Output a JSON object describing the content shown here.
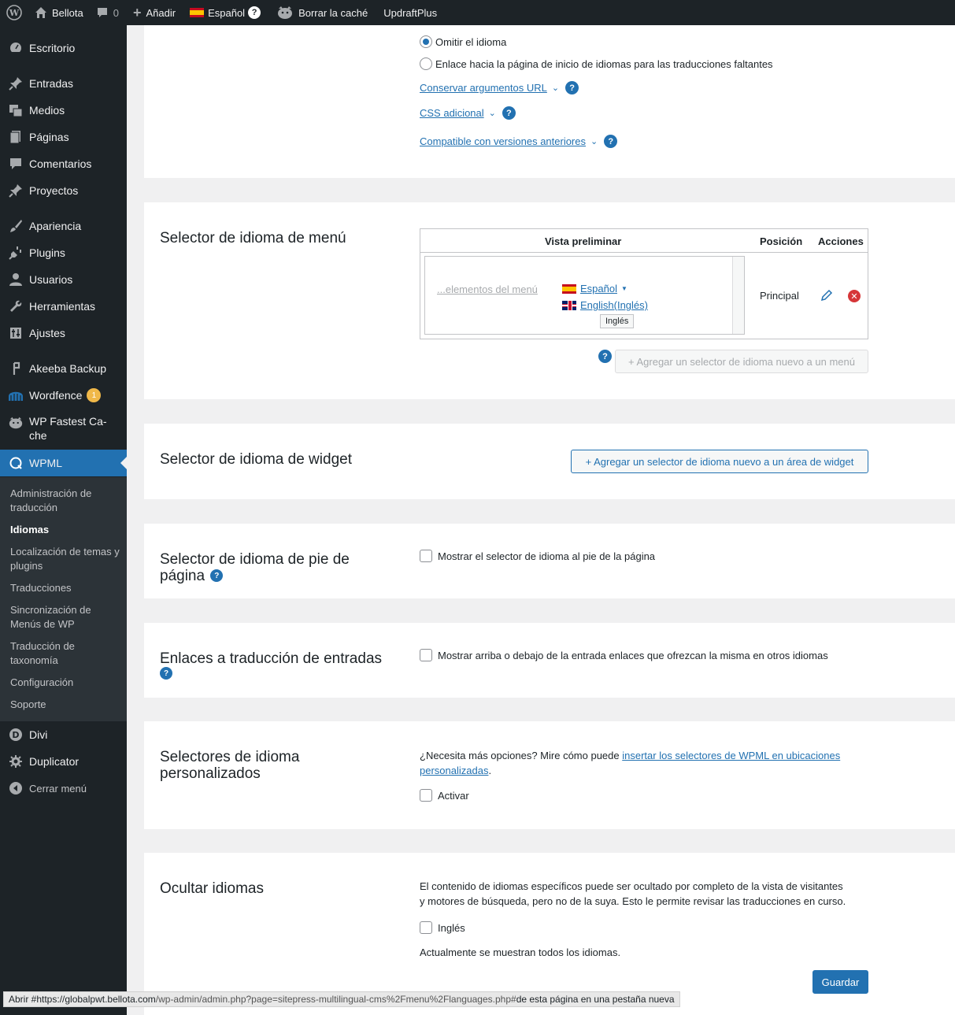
{
  "adminbar": {
    "site_name": "Bellota",
    "comments_count": "0",
    "add_label": "Añadir",
    "language_label": "Español",
    "cache_label": "Borrar la caché",
    "updraft_label": "UpdraftPlus"
  },
  "sidebar": {
    "items": [
      {
        "label": "Escritorio",
        "icon": "dashboard-icon"
      },
      {
        "label": "Entradas",
        "icon": "pin-icon"
      },
      {
        "label": "Medios",
        "icon": "media-icon"
      },
      {
        "label": "Páginas",
        "icon": "pages-icon"
      },
      {
        "label": "Comentarios",
        "icon": "comment-icon"
      },
      {
        "label": "Proyectos",
        "icon": "pin-icon"
      },
      {
        "label": "Apariencia",
        "icon": "brush-icon"
      },
      {
        "label": "Plugins",
        "icon": "plugin-icon"
      },
      {
        "label": "Usuarios",
        "icon": "user-icon"
      },
      {
        "label": "Herramientas",
        "icon": "wrench-icon"
      },
      {
        "label": "Ajustes",
        "icon": "settings-icon"
      },
      {
        "label": "Akeeba Backup",
        "icon": "akeeba-icon"
      },
      {
        "label": "Wordfence",
        "icon": "wordfence-icon",
        "badge": "1"
      },
      {
        "label": "WP Fastest Ca-che",
        "icon": "cheetah-icon"
      },
      {
        "label": "WPML",
        "icon": "wpml-icon"
      },
      {
        "label": "Divi",
        "icon": "divi-icon"
      },
      {
        "label": "Duplicator",
        "icon": "duplicator-icon"
      },
      {
        "label": "Cerrar menú",
        "icon": "collapse-icon"
      }
    ],
    "submenu": [
      "Administración de traducción",
      "Idiomas",
      "Localización de temas y plugins",
      "Traducciones",
      "Sincronización de Menús de WP",
      "Traducción de taxonomía",
      "Configuración",
      "Soporte"
    ],
    "fastest_cache_line1": "WP Fastest Ca-",
    "fastest_cache_line2": "che"
  },
  "top_panel": {
    "radio_skip": "Omitir el idioma",
    "radio_link_home": "Enlace hacia la página de inicio de idiomas para las traducciones faltantes",
    "preserve_url": "Conservar argumentos URL",
    "additional_css": "CSS adicional",
    "backwards_compat": "Compatible con versiones anteriores"
  },
  "menu_selector": {
    "title": "Selector de idioma de menú",
    "col_preview": "Vista preliminar",
    "col_position": "Posición",
    "col_actions": "Acciones",
    "menu_items_text": "...elementos del menú",
    "lang_current": "Español",
    "lang_other": "English(Inglés)",
    "tooltip": "Inglés",
    "position_value": "Principal",
    "add_button": "+ Agregar un selector de idioma nuevo a un menú"
  },
  "widget_selector": {
    "title": "Selector de idioma de widget",
    "add_button": "+ Agregar un selector de idioma nuevo a un área de widget"
  },
  "footer_selector": {
    "title_line1": "Selector de idioma de pie de",
    "title_line2": "página",
    "checkbox_label": "Mostrar el selector de idioma al pie de la página"
  },
  "post_links": {
    "title": "Enlaces a traducción de entradas",
    "checkbox_label": "Mostrar arriba o debajo de la entrada enlaces que ofrezcan la misma en otros idiomas"
  },
  "custom_selectors": {
    "title_line1": "Selectores de idioma",
    "title_line2": "personalizados",
    "text_before": "¿Necesita más opciones? Mire cómo puede ",
    "link_line1": "insertar los selectores de WPML en ubicaciones",
    "link_line2": "personalizadas",
    "text_after": ".",
    "checkbox_label": "Activar"
  },
  "hide_languages": {
    "title": "Ocultar idiomas",
    "desc_line1": "El contenido de idiomas específicos puede ser ocultado por completo de la vista de visitantes",
    "desc_line2": "y motores de búsqueda, pero no de la suya. Esto le permite revisar las traducciones en curso.",
    "checkbox_label": "Inglés",
    "status": "Actualmente se muestran todos los idiomas.",
    "save_button": "Guardar"
  },
  "statusbar": {
    "prefix": "Abrir #https://globalpwt.bellota.com",
    "path": "/wp-admin/admin.php?page=sitepress-multilingual-cms%2Fmenu%2Flanguages.php#",
    "suffix": " de esta página en una pestaña nueva"
  },
  "colors": {
    "admin_dark": "#1d2327",
    "accent": "#2271b1",
    "submenu_bg": "#2c3338",
    "badge": "#f0b849",
    "delete": "#d63638"
  }
}
